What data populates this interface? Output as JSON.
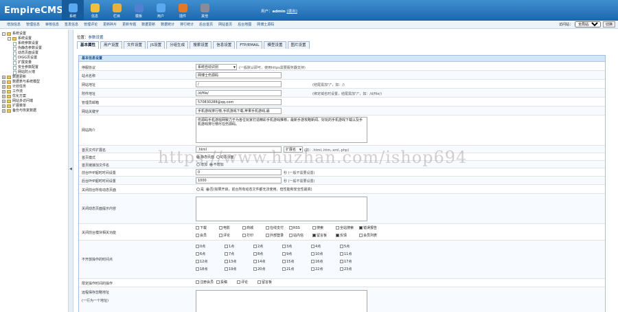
{
  "brand": "EmpireCMS",
  "nav": [
    "系统",
    "信息",
    "栏目",
    "模板",
    "用户",
    "插件",
    "其他"
  ],
  "nav_colors": [
    "#5aa9f0",
    "#f0c040",
    "#e8b040",
    "#5080d0",
    "#5aa9f0",
    "#e07a2a",
    "#8a8a9a"
  ],
  "user": {
    "prefix": "用户：",
    "name": "admin",
    "exit": "[退出]"
  },
  "sub": [
    "增加信息",
    "管理信息",
    "审核信息",
    "签发信息",
    "管理评论",
    "更新碎片",
    "更新专题",
    "数据更新",
    "数据统计",
    "排行统计",
    "后台首页",
    "网站首页",
    "后台地图",
    "网博士源码"
  ],
  "site": {
    "label": "访问站：",
    "sel": "全局站点",
    "btn": "切换"
  },
  "tree": [
    {
      "t": "系统设置",
      "lv": 1,
      "k": "-",
      "i": "f"
    },
    {
      "t": "系统设置",
      "lv": 2,
      "k": "-",
      "i": "f"
    },
    {
      "t": "系统参数设置",
      "lv": 3,
      "i": "d"
    },
    {
      "t": "伪静态参数设置",
      "lv": 3,
      "i": "d"
    },
    {
      "t": "动态页面设置",
      "lv": 3,
      "i": "d"
    },
    {
      "t": "DIGG页设置",
      "lv": 3,
      "i": "d"
    },
    {
      "t": "扩展变量",
      "lv": 3,
      "i": "d"
    },
    {
      "t": "安全参数配置",
      "lv": 3,
      "i": "d"
    },
    {
      "t": "网站防火墙",
      "lv": 3,
      "i": "d"
    },
    {
      "t": "数据更新",
      "lv": 1,
      "k": "+",
      "i": "f"
    },
    {
      "t": "数据表与系统模型",
      "lv": 1,
      "k": "+",
      "i": "f"
    },
    {
      "t": "计划任务",
      "lv": 1,
      "k": "+",
      "i": "f"
    },
    {
      "t": "工作流",
      "lv": 1,
      "k": "+",
      "i": "f"
    },
    {
      "t": "优化方案",
      "lv": 1,
      "k": "+",
      "i": "f"
    },
    {
      "t": "网站多访问端",
      "lv": 1,
      "k": "+",
      "i": "f"
    },
    {
      "t": "扩展菜单",
      "lv": 1,
      "k": "+",
      "i": "f"
    },
    {
      "t": "备份与恢复数据",
      "lv": 1,
      "k": "+",
      "i": "f"
    }
  ],
  "crumb": {
    "prefix": "位置：",
    "link": "参数设置"
  },
  "tabs": [
    "基本属性",
    "用户设置",
    "文件设置",
    "JS设置",
    "分组生成",
    "搜索设置",
    "信息设置",
    "FTP/EMAIL",
    "模型设置",
    "图片设置"
  ],
  "box_title": "基本信息设置",
  "form": {
    "r1": {
      "l": "停服协议",
      "v": "系统自动识别",
      "h": "(一般默认即可，使用https需要服务器支持)"
    },
    "r2": {
      "l": "站点名称",
      "v": "网博士伤源码"
    },
    "r3": {
      "l": "网站地址",
      "v": "/",
      "h": "(结尾需加\"/\"，如：/)"
    },
    "r4": {
      "l": "附件地址",
      "v": "/d/file/",
      "h": "(绑定域名时设置，结尾需加\"/\"，如：/d/file/)"
    },
    "r5": {
      "l": "管理员邮箱",
      "v": "570830288@qq.com"
    },
    "r6": {
      "l": "网站关键字",
      "v": "手机游戏排行榜,手机游戏下载,苹果手机游戏,最"
    },
    "r7": {
      "l": "网站简介",
      "v": "伤源码手机游戏网致力于为各位玩家打造精彩手机游戏推荐，最新手游攻略新闻、好玩的手机游戏下载以及手机游戏排行榜尽在伤源码。"
    },
    "r8": {
      "l": "首页文件扩展名",
      "v": ".html",
      "s": "扩展名",
      "h": "(如：.html,.htm,.xml,.php)"
    },
    "r9": {
      "l": "首页模式",
      "a": "静态页面",
      "b": "动态页面"
    },
    "r10": {
      "l": "首页链接加文件名",
      "a": "增加",
      "b": "不增加"
    },
    "r11": {
      "l": "前台PHP超时时间设置",
      "v": "0",
      "h": "秒 (一般不需要设置)"
    },
    "r12": {
      "l": "后台PHP超时时间设置",
      "v": "1000",
      "h": "秒 (一般不需要设置)"
    },
    "r13": {
      "l": "关闭前台所有动态页面",
      "a": "是",
      "b": "否(如果开启，前台所有动态文件都无法使用，但性能和安全性最高)"
    },
    "r14": {
      "l": "关闭动态页面提示内容"
    },
    "r15": {
      "l": "关闭前台模块相关功能",
      "items": [
        "下载",
        "电影",
        "商城",
        "在线支付",
        "RSS",
        "搜索",
        "全站搜索",
        "错误报告",
        "会员",
        "评论",
        "打印",
        "外部登录",
        "站内信",
        "留言板",
        "反馈",
        "会员列表"
      ],
      "checked": [
        7,
        13,
        14
      ]
    },
    "r16": {
      "l": "不开放操作的时间点",
      "hours": [
        "0点",
        "1点",
        "2点",
        "3点",
        "4点",
        "5点",
        "6点",
        "7点",
        "8点",
        "9点",
        "10点",
        "11点",
        "12点",
        "13点",
        "14点",
        "15点",
        "16点",
        "17点",
        "18点",
        "19点",
        "20点",
        "21点",
        "22点",
        "23点"
      ]
    },
    "r17": {
      "l": "限定操作时间的操作",
      "items": [
        "注册会员",
        "投稿",
        "评论",
        "留言板"
      ]
    },
    "r18": {
      "l": "远程保存忽略地址",
      "sub": "(一行为一个地址)"
    }
  },
  "watermark": "https://www.huzhan.com/ishop694"
}
